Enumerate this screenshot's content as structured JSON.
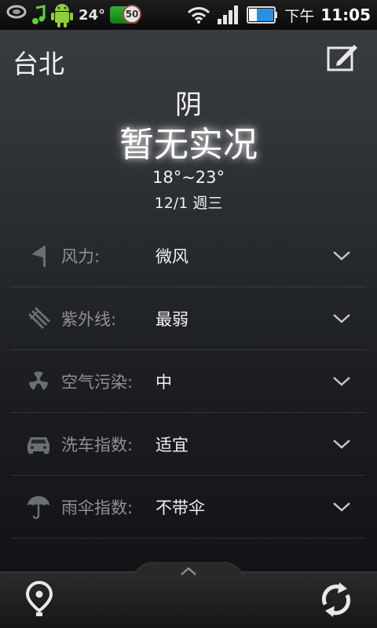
{
  "status_bar": {
    "temperature": "24°",
    "battery_badge": "50",
    "time_prefix": "下午",
    "time": "11:05"
  },
  "header": {
    "city": "台北"
  },
  "weather": {
    "condition": "阴",
    "live_status": "暂无实况",
    "temp_range": "18°~23°",
    "date": "12/1 週三"
  },
  "details": [
    {
      "label": "风力:",
      "value": "微风",
      "icon": "flag-icon"
    },
    {
      "label": "紫外线:",
      "value": "最弱",
      "icon": "uv-icon"
    },
    {
      "label": "空气污染:",
      "value": "中",
      "icon": "radiation-icon"
    },
    {
      "label": "洗车指数:",
      "value": "适宜",
      "icon": "car-icon"
    },
    {
      "label": "雨伞指数:",
      "value": "不带伞",
      "icon": "umbrella-icon"
    }
  ],
  "colors": {
    "label": "#8f9196",
    "value": "#f2f2f2",
    "icon": "#6b6e73"
  }
}
